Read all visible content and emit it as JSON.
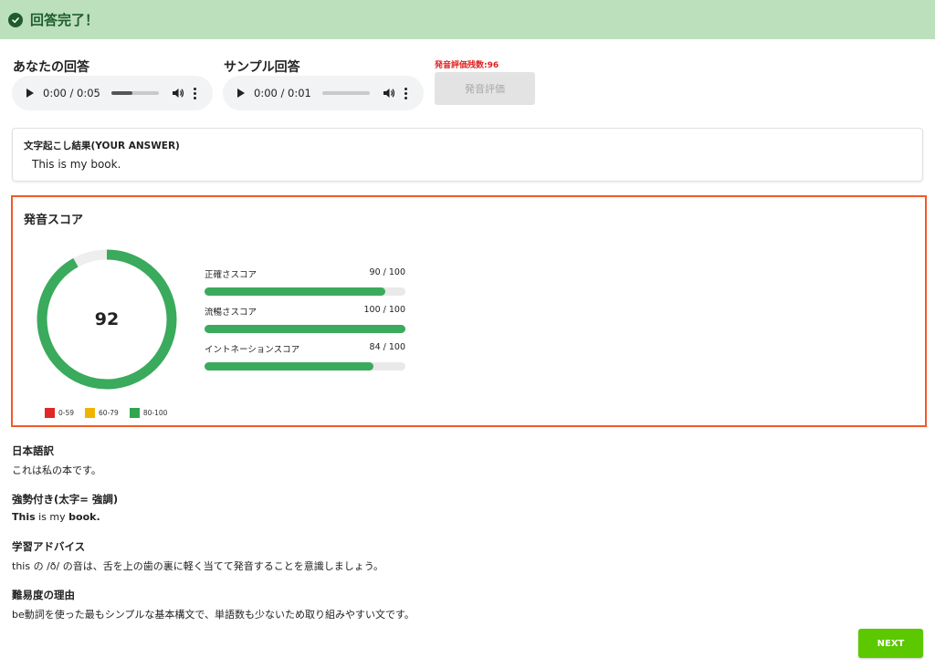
{
  "banner": {
    "title": "回答完了！",
    "icon": "check-circle-icon"
  },
  "your_answer": {
    "label": "あなたの回答",
    "time": "0:00 / 0:05",
    "progress": 0.45
  },
  "sample_answer": {
    "label": "サンプル回答",
    "time": "0:00 / 0:01",
    "progress": 0.0
  },
  "evaluation": {
    "remaining": "発音評価残数:96",
    "button_label": "発音評価"
  },
  "transcript": {
    "heading": "文字起こし結果(YOUR ANSWER)",
    "text": "This is my book."
  },
  "score": {
    "heading": "発音スコア",
    "total": "92",
    "total_value": 92,
    "metrics": [
      {
        "label": "正確さスコア",
        "score_text": "90 / 100",
        "value": 90
      },
      {
        "label": "流暢さスコア",
        "score_text": "100 / 100",
        "value": 100
      },
      {
        "label": "イントネーションスコア",
        "score_text": "84 / 100",
        "value": 84
      }
    ],
    "legend": [
      {
        "label": "0-59",
        "color": "#e02828"
      },
      {
        "label": "60-79",
        "color": "#f0b400"
      },
      {
        "label": "80-100",
        "color": "#2fa64f"
      }
    ]
  },
  "japanese_translation": {
    "heading": "日本語訳",
    "text": "これは私の本です。"
  },
  "stress": {
    "heading": "強勢付き(太字= 強調)",
    "bold1": "This",
    "plain": " is my ",
    "bold2": "book."
  },
  "advice": {
    "heading": "学習アドバイス",
    "text": "this の /ð/ の音は、舌を上の歯の裏に軽く当てて発音することを意識しましょう。"
  },
  "difficulty": {
    "heading": "難易度の理由",
    "text": "be動詞を使った最もシンプルな基本構文で、単語数も少ないため取り組みやすい文です。"
  },
  "next_button": {
    "label": "NEXT"
  },
  "colors": {
    "accent_green": "#3aaa5c",
    "highlight_border": "#f05a28",
    "banner_bg": "#bbe0bb",
    "next_bg": "#5bc800"
  }
}
